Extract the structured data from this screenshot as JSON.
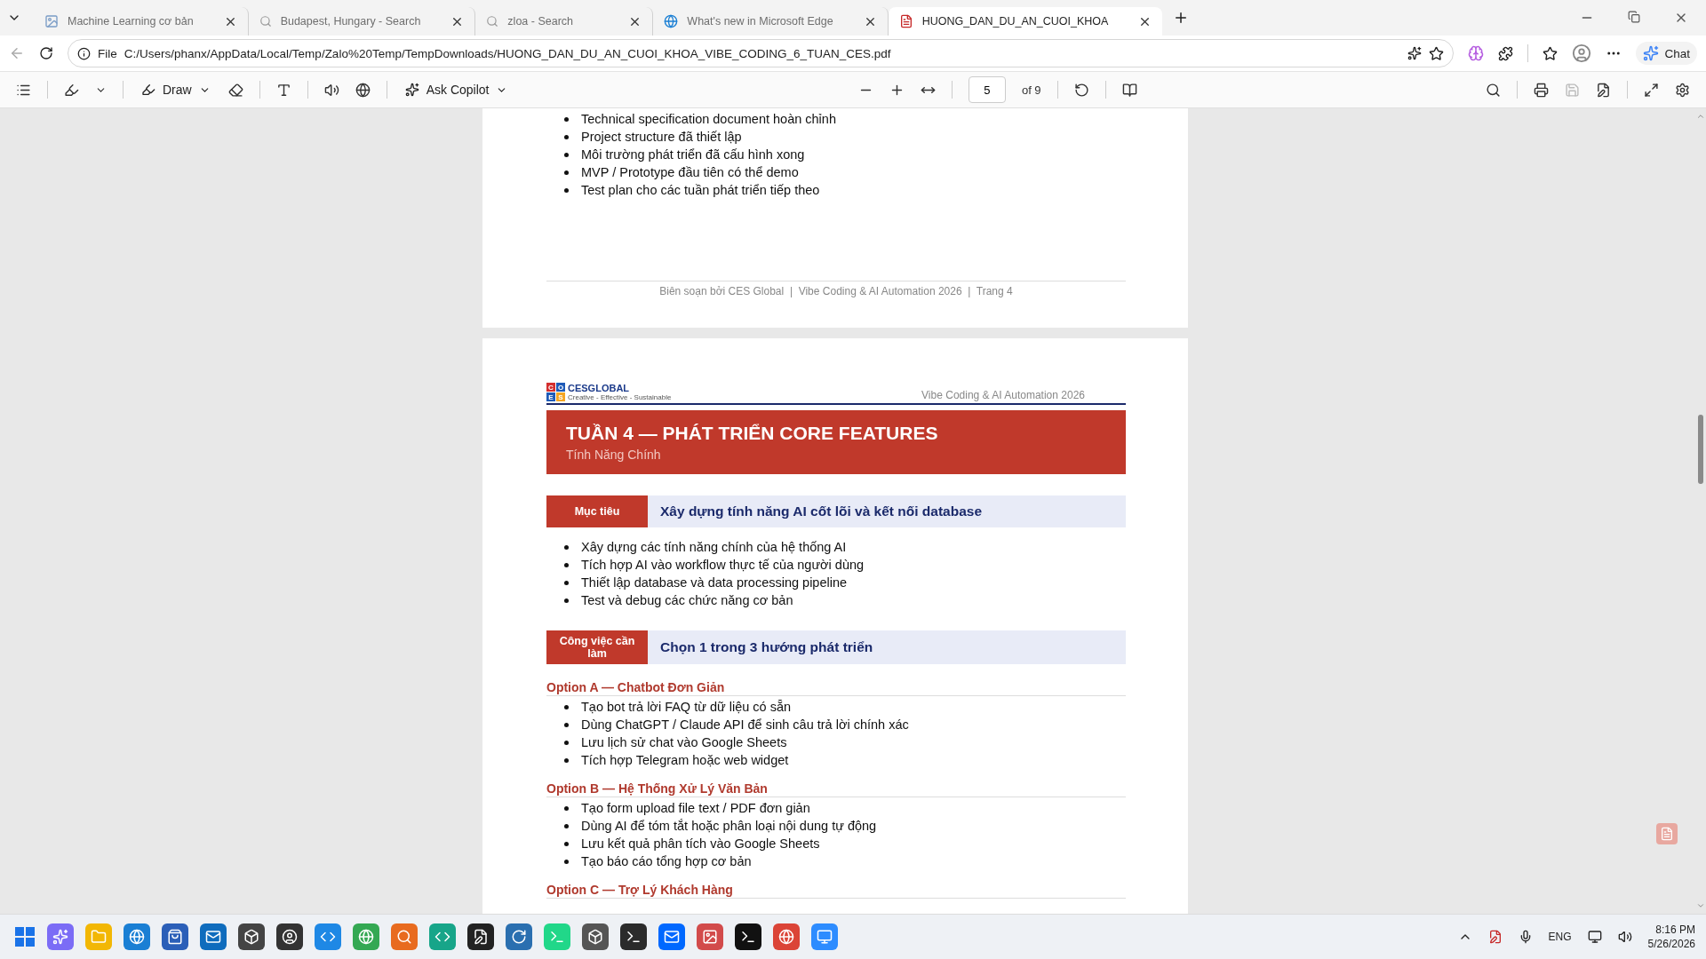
{
  "browser": {
    "tabs": [
      {
        "title": "Machine Learning cơ bản",
        "kind": "image",
        "selected": false
      },
      {
        "title": "Budapest, Hungary - Search",
        "kind": "search",
        "selected": false
      },
      {
        "title": "zloa - Search",
        "kind": "search",
        "selected": false
      },
      {
        "title": "What's new in Microsoft Edge",
        "kind": "edge",
        "selected": false
      },
      {
        "title": "HUONG_DAN_DU_AN_CUOI_KHOA",
        "kind": "pdf",
        "selected": true
      }
    ],
    "address": {
      "scheme": "File",
      "url": "C:/Users/phanx/AppData/Local/Temp/Zalo%20Temp/TempDownloads/HUONG_DAN_DU_AN_CUOI_KHOA_VIBE_CODING_6_TUAN_CES.pdf"
    },
    "chat_button": "Chat"
  },
  "pdf_toolbar": {
    "draw": "Draw",
    "ask_copilot": "Ask Copilot",
    "page_number": "5",
    "page_total": "of 9"
  },
  "document": {
    "previous_page": {
      "bullets": [
        "Technical specification document hoàn chỉnh",
        "Project structure đã thiết lập",
        "Môi trường phát triển đã cấu hình xong",
        "MVP / Prototype đầu tiên có thể demo",
        "Test plan cho các tuần phát triển tiếp theo"
      ],
      "footer": "Biên soạn bởi CES Global  |  Vibe Coding & AI Automation 2026  |  Trang 4"
    },
    "page": {
      "logo_letters": [
        "C",
        "O",
        "E",
        "S"
      ],
      "logo_name": "CESGLOBAL",
      "logo_tagline": "Creative - Effective - Sustainable",
      "header_right": "Vibe Coding & AI Automation 2026",
      "title": "TUẦN 4 — PHÁT TRIỂN CORE FEATURES",
      "subtitle": "Tính Năng Chính",
      "sections": [
        {
          "label": "Mục tiêu",
          "heading": "Xây dựng tính năng AI cốt lõi và kết nối database",
          "bullets": [
            "Xây dựng các tính năng chính của hệ thống AI",
            "Tích hợp AI vào workflow thực tế của người dùng",
            "Thiết lập database và data processing pipeline",
            "Test và debug các chức năng cơ bản"
          ]
        },
        {
          "label": "Công việc cần làm",
          "heading": "Chọn 1 trong 3 hướng phát triển"
        }
      ],
      "options": [
        {
          "title": "Option A — Chatbot Đơn Giản",
          "bullets": [
            "Tạo bot trả lời FAQ từ dữ liệu có sẵn",
            "Dùng ChatGPT / Claude API để sinh câu trả lời chính xác",
            "Lưu lịch sử chat vào Google Sheets",
            "Tích hợp Telegram hoặc web widget"
          ]
        },
        {
          "title": "Option B — Hệ Thống Xử Lý Văn Bản",
          "bullets": [
            "Tạo form upload file text / PDF đơn giản",
            "Dùng AI để tóm tắt hoặc phân loại nội dung tự động",
            "Lưu kết quả phân tích vào Google Sheets",
            "Tạo báo cáo tổng hợp cơ bản"
          ]
        },
        {
          "title": "Option C — Trợ Lý Khách Hàng"
        }
      ]
    }
  },
  "taskbar": {
    "language": "ENG",
    "time": "8:16 PM",
    "date": "5/26/2026"
  }
}
